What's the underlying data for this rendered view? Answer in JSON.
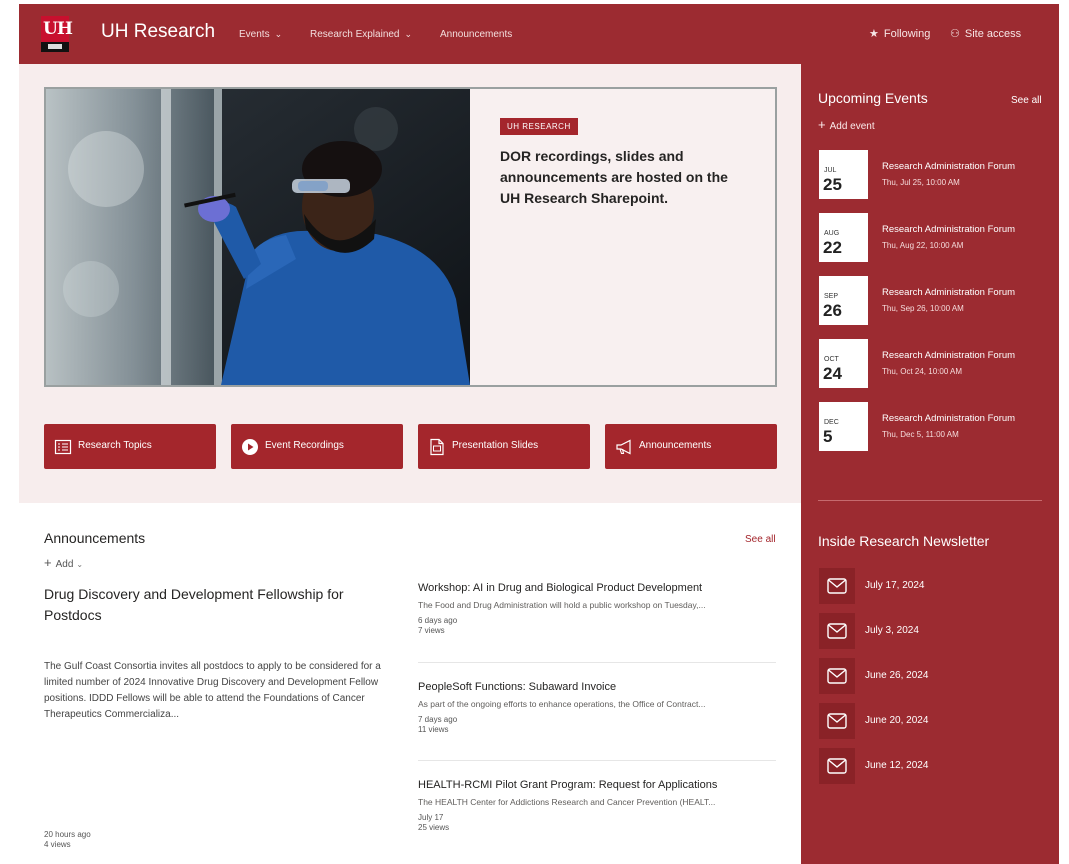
{
  "header": {
    "site_title": "UH Research",
    "nav": [
      {
        "label": "Events",
        "has_menu": true
      },
      {
        "label": "Research Explained",
        "has_menu": true
      },
      {
        "label": "Announcements",
        "has_menu": false
      }
    ],
    "actions": [
      {
        "label": "Following",
        "icon": "star-icon"
      },
      {
        "label": "Site access",
        "icon": "people-icon"
      }
    ]
  },
  "hero": {
    "tag": "UH RESEARCH",
    "headline": "DOR recordings, slides and announcements are hosted on the UH Research Sharepoint.",
    "image": "scientist-in-lab-photo"
  },
  "quick_links": [
    {
      "label": "Research Topics",
      "icon": "list-icon"
    },
    {
      "label": "Event Recordings",
      "icon": "play-icon"
    },
    {
      "label": "Presentation Slides",
      "icon": "slides-icon"
    },
    {
      "label": "Announcements",
      "icon": "megaphone-icon"
    }
  ],
  "announcements": {
    "title": "Announcements",
    "see_all": "See all",
    "add_label": "Add",
    "featured": {
      "title": "Drug Discovery and Development Fellowship for Postdocs",
      "body": "The Gulf Coast Consortia invites all postdocs to apply to be considered for a limited number of 2024 Innovative Drug Discovery and Development Fellow positions. IDDD Fellows will be able to attend the Foundations of Cancer Therapeutics Commercializa...",
      "time": "20 hours ago",
      "views": "4 views"
    },
    "items": [
      {
        "title": "Workshop: AI in Drug and Biological Product Development",
        "body": "The Food and Drug Administration will hold a public workshop on Tuesday,...",
        "time": "6 days ago",
        "views": "7 views"
      },
      {
        "title": "PeopleSoft Functions: Subaward Invoice",
        "body": "As part of the ongoing efforts to enhance operations, the Office of Contract...",
        "time": "7 days ago",
        "views": "11 views"
      },
      {
        "title": "HEALTH-RCMI Pilot Grant Program: Request for Applications",
        "body": "The HEALTH Center for Addictions Research and Cancer Prevention (HEALT...",
        "time": "July 17",
        "views": "25 views"
      }
    ]
  },
  "events": {
    "title": "Upcoming Events",
    "see_all": "See all",
    "add_label": "Add event",
    "items": [
      {
        "month": "JUL",
        "day": "25",
        "title": "Research Administration Forum",
        "time": "Thu, Jul 25, 10:00 AM"
      },
      {
        "month": "AUG",
        "day": "22",
        "title": "Research Administration Forum",
        "time": "Thu, Aug 22, 10:00 AM"
      },
      {
        "month": "SEP",
        "day": "26",
        "title": "Research Administration Forum",
        "time": "Thu, Sep 26, 10:00 AM"
      },
      {
        "month": "OCT",
        "day": "24",
        "title": "Research Administration Forum",
        "time": "Thu, Oct 24, 10:00 AM"
      },
      {
        "month": "DEC",
        "day": "5",
        "title": "Research Administration Forum",
        "time": "Thu, Dec 5, 11:00 AM"
      }
    ]
  },
  "newsletter": {
    "title": "Inside Research Newsletter",
    "items": [
      {
        "label": "July 17, 2024",
        "icon": "mail-icon"
      },
      {
        "label": "July 3, 2024",
        "icon": "mail-icon"
      },
      {
        "label": "June 26, 2024",
        "icon": "mail-icon"
      },
      {
        "label": "June 20, 2024",
        "icon": "mail-icon"
      },
      {
        "label": "June 12, 2024",
        "icon": "mail-icon"
      }
    ]
  },
  "colors": {
    "brand": "#9c2b31",
    "tile": "#a4262c",
    "hero_background": "#f7eded"
  }
}
